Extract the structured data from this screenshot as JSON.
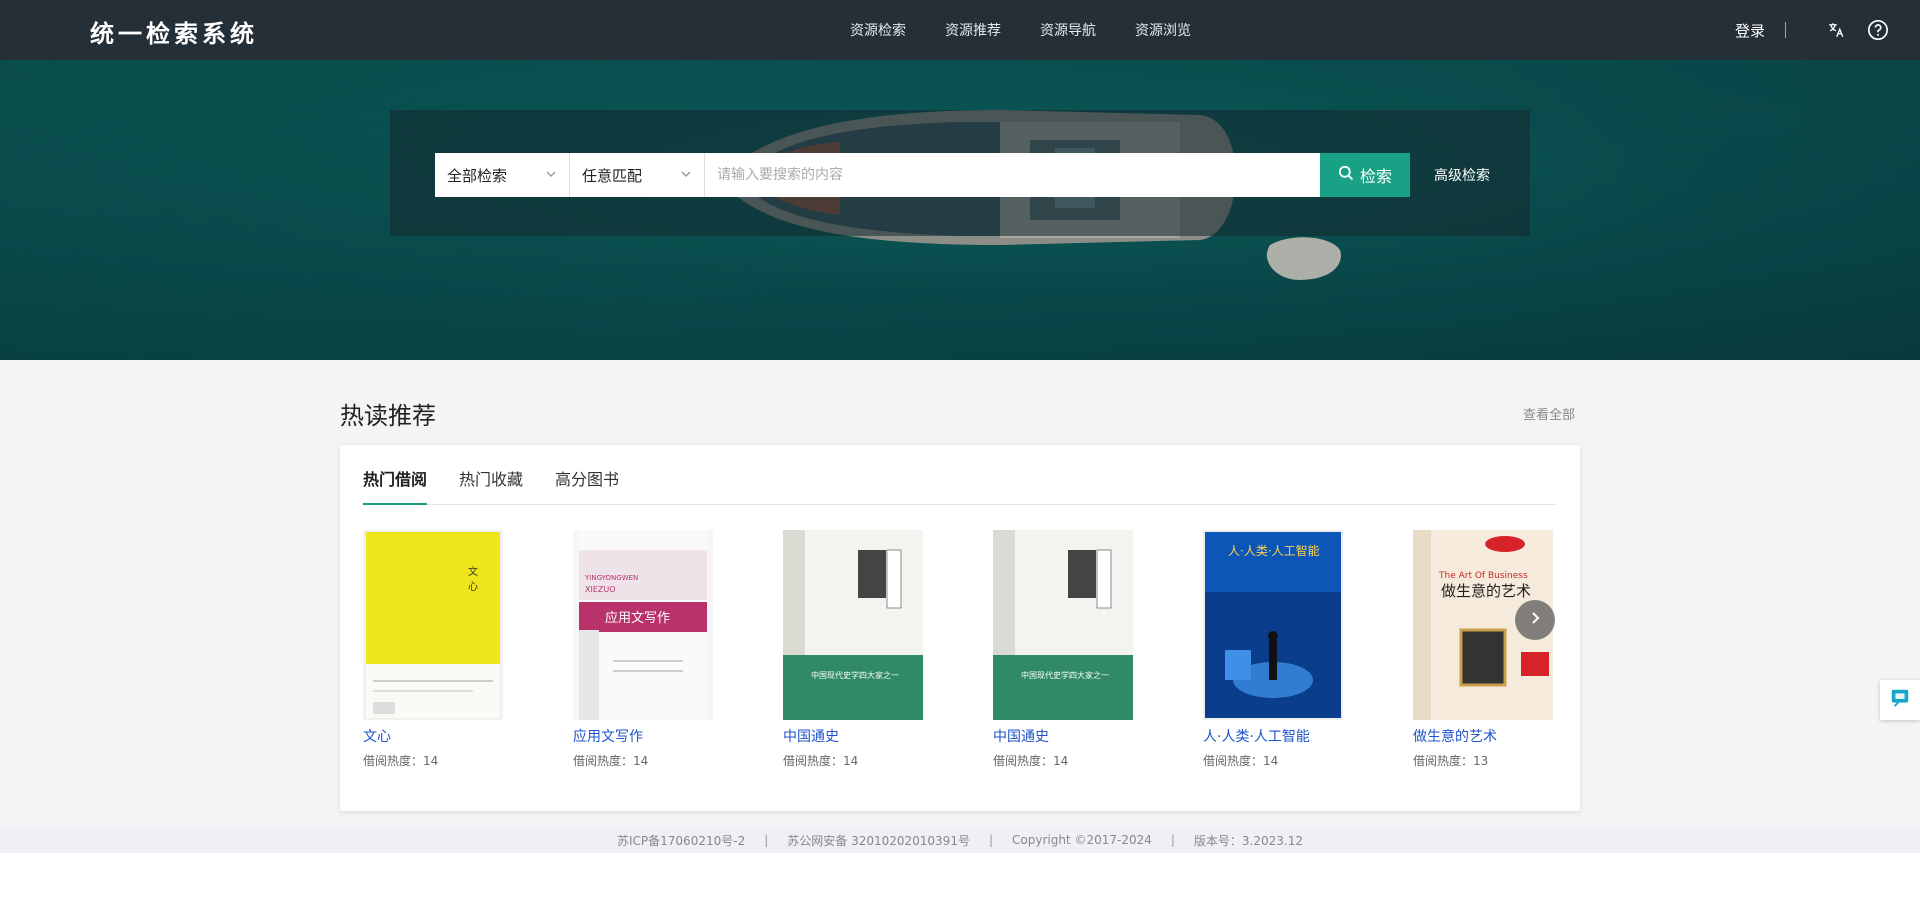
{
  "header": {
    "brand": "统一检索系统",
    "nav": [
      "资源检索",
      "资源推荐",
      "资源导航",
      "资源浏览"
    ],
    "login": "登录"
  },
  "search": {
    "scope": "全部检索",
    "match": "任意匹配",
    "placeholder": "请输入要搜索的内容",
    "button": "检索",
    "advanced": "高级检索"
  },
  "section": {
    "title": "热读推荐",
    "view_all": "查看全部",
    "tabs": [
      "热门借阅",
      "热门收藏",
      "高分图书"
    ],
    "active_tab": 0
  },
  "books": [
    {
      "title": "文心",
      "heat": "借阅热度：14"
    },
    {
      "title": "应用文写作",
      "heat": "借阅热度：14"
    },
    {
      "title": "中国通史",
      "heat": "借阅热度：14"
    },
    {
      "title": "中国通史",
      "heat": "借阅热度：14"
    },
    {
      "title": "人·人类·人工智能",
      "heat": "借阅热度：14"
    },
    {
      "title": "做生意的艺术",
      "heat": "借阅热度：13"
    }
  ],
  "footer": [
    "苏ICP备17060210号-2",
    "苏公网安备 32010202010391号",
    "Copyright ©2017-2024",
    "版本号：3.2023.12"
  ],
  "colors": {
    "topbar": "#252f38",
    "accent": "#19a185",
    "link": "#1f54c9"
  }
}
